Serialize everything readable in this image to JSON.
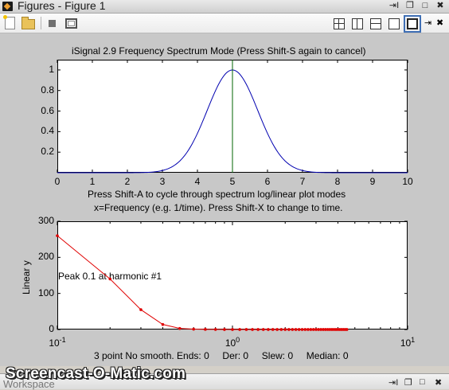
{
  "window": {
    "title": "Figures - Figure 1",
    "controls": {
      "undock": "⇥I",
      "restore": "❐",
      "maximize": "□",
      "close": "✖"
    }
  },
  "toolbar": {
    "right_controls": {
      "undock": "⇥",
      "close": "✖"
    }
  },
  "plot_top": {
    "title": "iSignal 2.9 Frequency Spectrum Mode (Press Shift-S again to cancel)",
    "xlabel_line1": "Press Shift-A to cycle through spectrum log/linear plot modes",
    "xlabel_line2": "x=Frequency (e.g. 1/time). Press Shift-X to change to time.",
    "x_ticks": [
      "0",
      "1",
      "2",
      "3",
      "4",
      "5",
      "6",
      "7",
      "8",
      "9",
      "10"
    ],
    "y_ticks": [
      "1",
      "0.8",
      "0.6",
      "0.4",
      "0.2"
    ]
  },
  "plot_bottom": {
    "ylabel": "Linear y",
    "annotation": "Peak 0.1 at harmonic #1",
    "status": "3 point No smooth. Ends: 0     Der: 0     Slew: 0     Median: 0",
    "y_ticks": [
      "300",
      "200",
      "100",
      "0"
    ],
    "x_ticks": [
      {
        "base": "10",
        "exp": "-1"
      },
      {
        "base": "10",
        "exp": "0"
      },
      {
        "base": "10",
        "exp": "1"
      }
    ]
  },
  "chart_data": [
    {
      "type": "line",
      "title": "iSignal 2.9 Frequency Spectrum Mode (Press Shift-S again to cancel)",
      "xlabel": "Press Shift-A to cycle through spectrum log/linear plot modes / x=Frequency (e.g. 1/time). Press Shift-X to change to time.",
      "ylabel": "",
      "xlim": [
        0,
        10
      ],
      "ylim": [
        0,
        1.1
      ],
      "series": [
        {
          "color": "#0000b0",
          "gaussian": {
            "center": 5,
            "fwhm": 1.7,
            "height": 1
          }
        }
      ],
      "cursor_x": 5,
      "cursor_color": "#006400"
    },
    {
      "type": "line",
      "xscale": "log",
      "xlim": [
        0.1,
        10
      ],
      "ylim": [
        0,
        300
      ],
      "ylabel": "Linear y",
      "series": [
        {
          "color": "#e00000",
          "x": [
            0.1,
            0.2,
            0.3,
            0.4,
            0.5,
            0.6,
            0.7,
            0.8,
            0.9,
            1.0,
            1.1,
            1.2,
            1.3,
            1.4,
            1.5,
            1.6,
            1.7,
            1.8,
            1.9,
            2.0,
            2.1,
            2.2,
            2.3,
            2.4,
            2.5,
            2.6,
            2.7,
            2.8,
            2.9,
            3.0,
            3.1,
            3.2,
            3.3,
            3.4,
            3.5,
            3.6,
            3.7,
            3.8,
            3.9,
            4.0,
            4.1,
            4.2,
            4.3,
            4.4,
            4.5
          ],
          "y": [
            260,
            140,
            55,
            14,
            3,
            1,
            0.4,
            0.2,
            0.1,
            0.1,
            0.1,
            0.1,
            0.1,
            0.1,
            0.1,
            0.1,
            0.1,
            0.1,
            0.1,
            0.1,
            0.1,
            0.1,
            0.1,
            0.1,
            0.1,
            0.1,
            0.1,
            0.1,
            0.1,
            0.1,
            0.1,
            0.1,
            0.1,
            0.1,
            0.1,
            0.1,
            0.1,
            0.1,
            0.1,
            0.1,
            0.1,
            0.1,
            0.1,
            0.1,
            0.1
          ]
        }
      ]
    }
  ],
  "watermark": "Screencast-O-Matic.com",
  "workspace_bar": {
    "title": "Workspace",
    "controls": {
      "undock": "⇥I",
      "restore": "❐",
      "maximize": "□",
      "close": "✖"
    }
  }
}
